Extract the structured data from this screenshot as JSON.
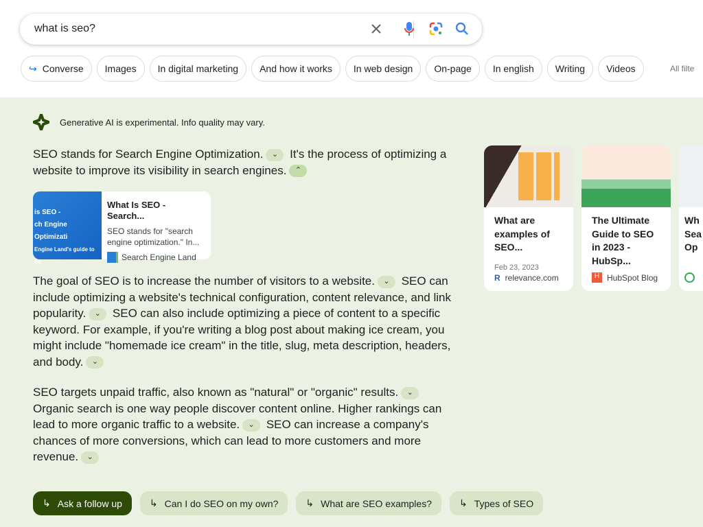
{
  "search": {
    "query": "what is seo?"
  },
  "chips": [
    "Converse",
    "Images",
    "In digital marketing",
    "And how it works",
    "In web design",
    "On-page",
    "In english",
    "Writing",
    "Videos"
  ],
  "all_filters": "All filte",
  "notice": "Generative AI is experimental. Info quality may vary.",
  "paragraphs": [
    [
      {
        "t": "SEO stands for Search Engine Optimization."
      },
      {
        "chev": "down"
      },
      {
        "t": " It's the process of optimizing a website to improve its visibility in search engines."
      },
      {
        "chev": "up"
      }
    ],
    [
      {
        "t": "The goal of SEO is to increase the number of visitors to a website."
      },
      {
        "chev": "down"
      },
      {
        "t": " SEO can include optimizing a website's technical configuration, content relevance, and link popularity."
      },
      {
        "chev": "down"
      },
      {
        "t": " SEO can also include optimizing a piece of content to a specific keyword. For example, if you're writing a blog post about making ice cream, you might include \"homemade ice cream\" in the title, slug, meta description, headers, and body."
      },
      {
        "chev": "down"
      }
    ],
    [
      {
        "t": "SEO targets unpaid traffic, also known as \"natural\" or \"organic\" results."
      },
      {
        "chev": "down"
      },
      {
        "t": " Organic search is one way people discover content online. Higher rankings can lead to more organic traffic to a website."
      },
      {
        "chev": "down"
      },
      {
        "t": " SEO can increase a company's chances of more conversions, which can lead to more customers and more revenue."
      },
      {
        "chev": "down"
      }
    ]
  ],
  "source_card": {
    "image_text": [
      "is SEO -",
      "ch Engine Optimizati",
      "Engine Land's guide to SE"
    ],
    "title": "What Is SEO - Search...",
    "desc": "SEO stands for \"search engine optimization.\" In...",
    "site": "Search Engine Land",
    "logo": "SEL"
  },
  "cards": [
    {
      "title": "What are examples of SEO...",
      "date": "Feb 23, 2023",
      "site": "relevance.com",
      "logo": "R"
    },
    {
      "title": "The Ultimate Guide to SEO in 2023 - HubSp...",
      "date": "",
      "site": "HubSpot Blog",
      "logo": "H"
    },
    {
      "title": "Wh Sea Op",
      "date": "",
      "site": "",
      "logo": ""
    }
  ],
  "followups": [
    "Ask a follow up",
    "Can I do SEO on my own?",
    "What are SEO examples?",
    "Types of SEO"
  ],
  "colors": {
    "accent": "#2d4b07",
    "sge_bg": "#ecf2e3",
    "chip_bg": "#d9e5c8"
  }
}
